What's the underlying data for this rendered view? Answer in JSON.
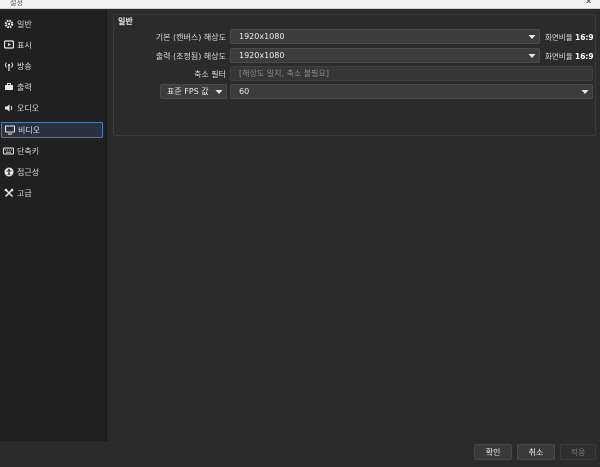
{
  "window": {
    "title": "설정"
  },
  "sidebar": {
    "items": [
      {
        "label": "일반",
        "icon": "gear-icon"
      },
      {
        "label": "표시",
        "icon": "stream-icon"
      },
      {
        "label": "방송",
        "icon": "broadcast-icon"
      },
      {
        "label": "출력",
        "icon": "output-icon"
      },
      {
        "label": "오디오",
        "icon": "speaker-icon"
      },
      {
        "label": "비디오",
        "icon": "monitor-icon",
        "active": true
      },
      {
        "label": "단축키",
        "icon": "keyboard-icon"
      },
      {
        "label": "접근성",
        "icon": "accessibility-icon"
      },
      {
        "label": "고급",
        "icon": "tools-icon"
      }
    ]
  },
  "video": {
    "group_title": "일반",
    "base_resolution": {
      "label": "기본 (캔버스) 해상도",
      "value": "1920x1080",
      "aspect_prefix": "화면비율",
      "aspect": "16:9"
    },
    "output_resolution": {
      "label": "출력 (조정됨) 해상도",
      "value": "1920x1080",
      "aspect_prefix": "화면비율",
      "aspect": "16:9"
    },
    "downscale_filter": {
      "label": "축소 필터",
      "value": "[해상도 일치, 축소 불필요]"
    },
    "fps": {
      "type_label": "표준 FPS 값",
      "value": "60"
    }
  },
  "footer": {
    "ok_label": "확인",
    "cancel_label": "취소",
    "apply_label": "적용"
  },
  "colors": {
    "accent": "#4f7ab8",
    "background": "#2b2b2b",
    "sidebar": "#202020"
  }
}
